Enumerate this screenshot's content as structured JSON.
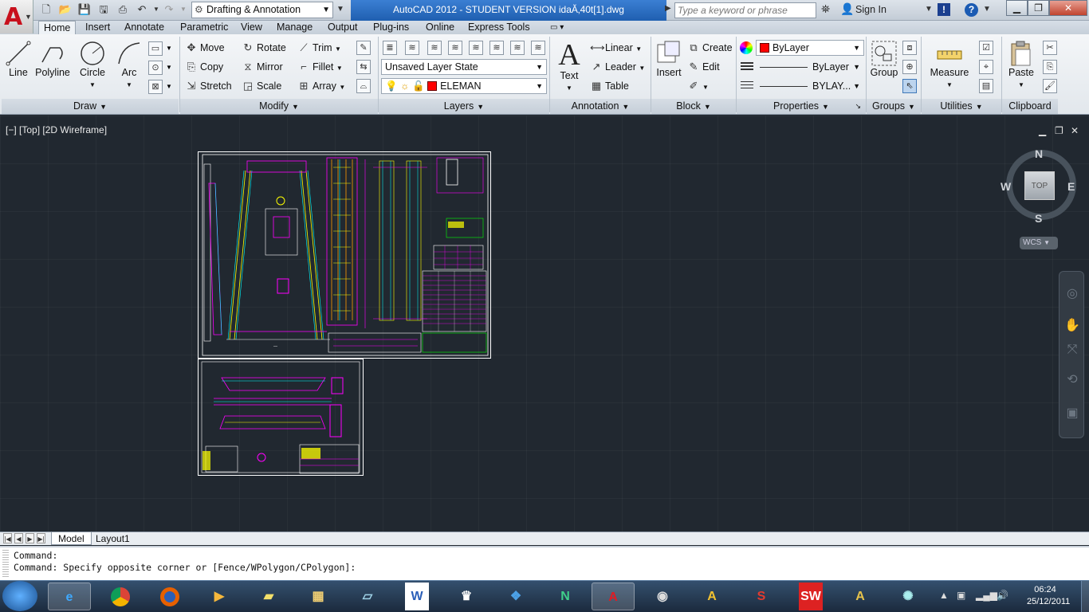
{
  "titlebar": {
    "workspace": "Drafting & Annotation",
    "title": "AutoCAD 2012 - STUDENT VERSION    idaĂ‚40t[1].dwg",
    "search_placeholder": "Type a keyword or phrase",
    "sign_in": "Sign In"
  },
  "tabs": [
    "Home",
    "Insert",
    "Annotate",
    "Parametric",
    "View",
    "Manage",
    "Output",
    "Plug-ins",
    "Online",
    "Express Tools"
  ],
  "draw": {
    "line": "Line",
    "polyline": "Polyline",
    "circle": "Circle",
    "arc": "Arc",
    "title": "Draw"
  },
  "modify": {
    "move": "Move",
    "rotate": "Rotate",
    "trim": "Trim",
    "copy": "Copy",
    "mirror": "Mirror",
    "fillet": "Fillet",
    "stretch": "Stretch",
    "scale": "Scale",
    "array": "Array",
    "title": "Modify"
  },
  "layers": {
    "layer_state": "Unsaved Layer State",
    "current_layer": "ELEMAN",
    "title": "Layers"
  },
  "annotation": {
    "text": "Text",
    "linear": "Linear",
    "leader": "Leader",
    "table": "Table",
    "title": "Annotation"
  },
  "block": {
    "insert": "Insert",
    "create": "Create",
    "edit": "Edit",
    "title": "Block"
  },
  "properties": {
    "color": "ByLayer",
    "linetype": "ByLayer",
    "lineweight": "BYLAY...",
    "title": "Properties"
  },
  "groups": {
    "group": "Group",
    "title": "Groups"
  },
  "utilities": {
    "measure": "Measure",
    "title": "Utilities"
  },
  "clipboard": {
    "paste": "Paste",
    "title": "Clipboard"
  },
  "viewport": {
    "label": "[−] [Top] [2D Wireframe]"
  },
  "viewcube": {
    "n": "N",
    "s": "S",
    "e": "E",
    "w": "W",
    "top": "TOP",
    "wcs": "WCS"
  },
  "layout_tabs": [
    "Model",
    "Layout1"
  ],
  "command_lines": [
    "Command:",
    "Command: Specify opposite corner or [Fence/WPolygon/CPolygon]:"
  ],
  "taskbar": {
    "time": "06:24",
    "date": "25/12/2011"
  },
  "colors": {
    "accent": "#1f5fb0",
    "viewport_bg": "#212830",
    "layer_color": "#ff0000"
  }
}
